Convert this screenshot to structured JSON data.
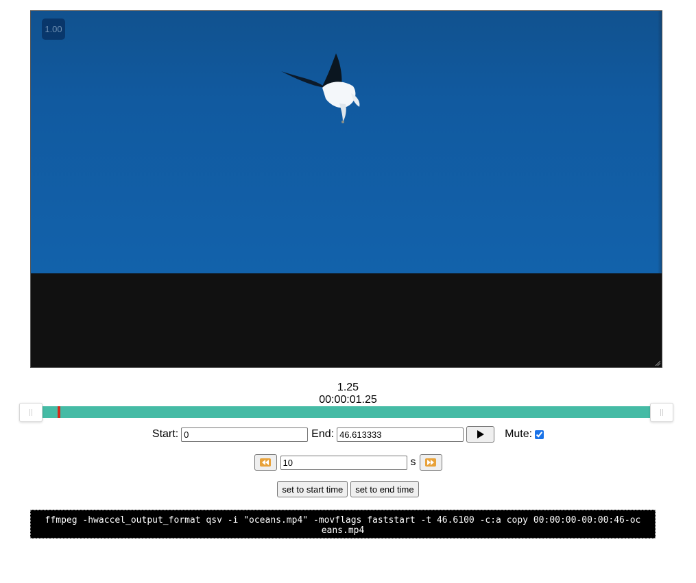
{
  "video": {
    "playback_rate_badge": "1.00"
  },
  "playback": {
    "current_seconds": "1.25",
    "current_timecode": "00:00:01.25",
    "position_fraction": 0.027
  },
  "range": {
    "start_label": "Start:",
    "start_value": "0",
    "end_label": "End:",
    "end_value": "46.613333",
    "play_icon": "play-icon",
    "mute_label": "Mute:",
    "mute_checked": true
  },
  "seek": {
    "back_icon": "rewind-icon",
    "step_value": "10",
    "unit": "s",
    "forward_icon": "fast-forward-icon"
  },
  "actions": {
    "set_start_label": "set to start time",
    "set_end_label": "set to end time"
  },
  "command": {
    "text": "ffmpeg -hwaccel_output_format qsv -i \"oceans.mp4\" -movflags faststart -t 46.6100 -c:a copy 00:00:00-00:00:46-oceans.mp4"
  },
  "colors": {
    "track": "#45bba5",
    "playhead": "#d42a1c",
    "sky": "#115aa0"
  }
}
